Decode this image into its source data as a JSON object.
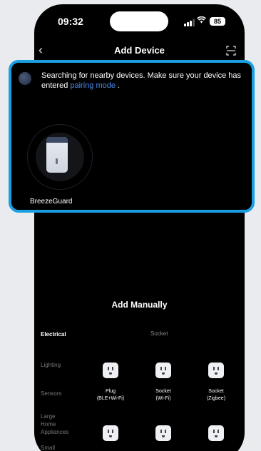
{
  "status": {
    "time": "09:32",
    "battery": "85"
  },
  "nav": {
    "title": "Add Device",
    "back_icon": "chevron-left-icon",
    "scan_icon": "scan-icon"
  },
  "search": {
    "text_prefix": "Searching for nearby devices. Make sure your device has entered",
    "pairing_link": "pairing mode",
    "text_suffix": ".",
    "device_name": "BreezeGuard",
    "accent_color": "#1aa0e2",
    "link_color": "#4a8cf0"
  },
  "manual": {
    "title": "Add Manually",
    "categories": [
      "Electrical",
      "Lighting",
      "Sensors",
      "Large Home Appliances",
      "Small"
    ],
    "socket_header": "Socket",
    "devices": [
      {
        "line1": "Plug",
        "line2": "(BLE+Wi-Fi)"
      },
      {
        "line1": "Socket",
        "line2": "(Wi-Fi)"
      },
      {
        "line1": "Socket",
        "line2": "(Zigbee)"
      }
    ]
  }
}
